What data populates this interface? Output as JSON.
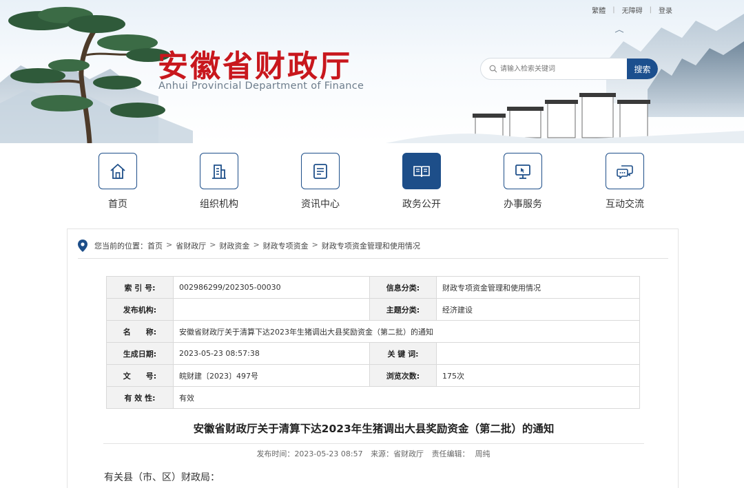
{
  "header": {
    "top_links": [
      "繁體",
      "无障碍",
      "登录"
    ],
    "logo_cn": "安徽省财政厅",
    "logo_en": "Anhui Provincial Department of Finance",
    "search_placeholder": "请输入检索关键词",
    "search_button": "搜索"
  },
  "nav": {
    "items": [
      {
        "label": "首页",
        "icon": "home-icon"
      },
      {
        "label": "组织机构",
        "icon": "organization-icon"
      },
      {
        "label": "资讯中心",
        "icon": "news-icon"
      },
      {
        "label": "政务公开",
        "icon": "book-icon",
        "active": true
      },
      {
        "label": "办事服务",
        "icon": "monitor-cursor-icon"
      },
      {
        "label": "互动交流",
        "icon": "chat-icon"
      }
    ]
  },
  "breadcrumb": {
    "prefix": "您当前的位置：",
    "items": [
      "首页",
      "省财政厅",
      "财政资金",
      "财政专项资金",
      "财政专项资金管理和使用情况"
    ],
    "separator": ">"
  },
  "meta": {
    "index_label": "索 引 号:",
    "index_value": "002986299/202305-00030",
    "category_label": "信息分类:",
    "category_value": "财政专项资金管理和使用情况",
    "publisher_label": "发布机构:",
    "publisher_value": "",
    "topic_label": "主题分类:",
    "topic_value": "经济建设",
    "name_label": "名　　称:",
    "name_value": "安徽省财政厅关于清算下达2023年生猪调出大县奖励资金（第二批）的通知",
    "date_label": "生成日期:",
    "date_value": "2023-05-23 08:57:38",
    "keywords_label": "关 键 词:",
    "keywords_value": "",
    "docno_label": "文　　号:",
    "docno_value": "皖财建〔2023〕497号",
    "views_label": "浏览次数:",
    "views_value": "175次",
    "validity_label": "有 效 性:",
    "validity_value": "有效"
  },
  "article": {
    "title": "安徽省财政厅关于清算下达2023年生猪调出大县奖励资金（第二批）的通知",
    "pub_time_label": "发布时间：",
    "pub_time": "2023-05-23 08:57",
    "source_label": "来源：",
    "source": "省财政厅",
    "editor_label": "责任编辑：",
    "editor": "周纯",
    "salutation": "有关县（市、区）财政局："
  },
  "colors": {
    "brand_red": "#c8171d",
    "brand_blue": "#1d4e89"
  }
}
